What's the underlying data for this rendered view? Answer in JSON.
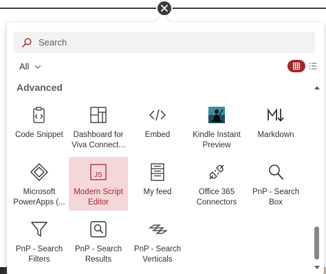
{
  "search": {
    "placeholder": "Search"
  },
  "filter": {
    "selected": "All"
  },
  "section": {
    "title": "Advanced"
  },
  "colors": {
    "accent": "#a4262c",
    "selected_bg": "#f4d7d9",
    "panel_bg": "#ffffff"
  },
  "tiles": [
    {
      "label": "Code Snippet",
      "icon": "clipboard-code-icon",
      "selected": false
    },
    {
      "label": "Dashboard for Viva Connect...",
      "icon": "dashboard-icon",
      "selected": false
    },
    {
      "label": "Embed",
      "icon": "embed-icon",
      "selected": false
    },
    {
      "label": "Kindle Instant Preview",
      "icon": "kindle-icon",
      "selected": false
    },
    {
      "label": "Markdown",
      "icon": "markdown-icon",
      "selected": false
    },
    {
      "label": "Microsoft PowerApps (...",
      "icon": "powerapps-icon",
      "selected": false
    },
    {
      "label": "Modern Script Editor",
      "icon": "js-icon",
      "selected": true
    },
    {
      "label": "My feed",
      "icon": "feed-icon",
      "selected": false
    },
    {
      "label": "Office 365 Connectors",
      "icon": "connector-plug-icon",
      "selected": false
    },
    {
      "label": "PnP - Search Box",
      "icon": "search-icon",
      "selected": false
    },
    {
      "label": "PnP - Search Filters",
      "icon": "filter-icon",
      "selected": false
    },
    {
      "label": "PnP - Search Results",
      "icon": "search-results-icon",
      "selected": false
    },
    {
      "label": "PnP - Search Verticals",
      "icon": "search-verticals-icon",
      "selected": false
    }
  ]
}
